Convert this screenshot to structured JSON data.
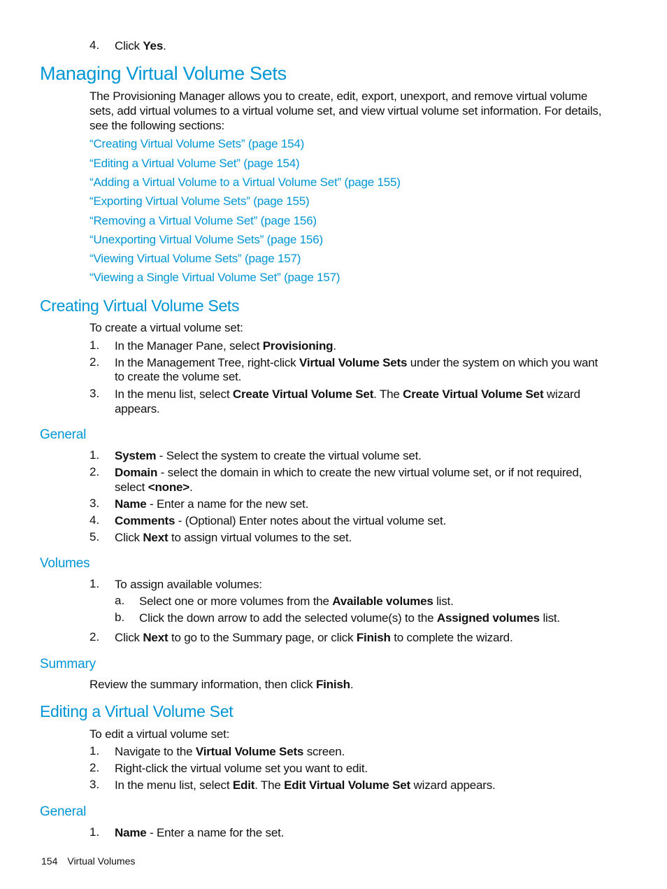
{
  "top_step": {
    "num": "4.",
    "pre": "Click ",
    "bold": "Yes",
    "post": "."
  },
  "managing": {
    "title": "Managing Virtual Volume Sets",
    "intro_lines": [
      "The Provisioning Manager allows you to create, edit, export, unexport, and remove virtual volume",
      "sets, add virtual volumes to a virtual volume set, and view virtual volume set information. For details,",
      "see the following sections:"
    ],
    "links": [
      "“Creating Virtual Volume Sets” (page 154)",
      "“Editing a Virtual Volume Set” (page 154)",
      "“Adding a Virtual Volume to a Virtual Volume Set” (page 155)",
      "“Exporting Virtual Volume Sets” (page 155)",
      "“Removing a Virtual Volume Set” (page 156)",
      "“Unexporting Virtual Volume Sets” (page 156)",
      "“Viewing Virtual Volume Sets” (page 157)",
      "“Viewing a Single Virtual Volume Set” (page 157)"
    ]
  },
  "creating": {
    "title": "Creating Virtual Volume Sets",
    "intro": "To create a virtual volume set:",
    "steps": [
      {
        "num": "1.",
        "t1": "In the Manager Pane, select ",
        "b1": "Provisioning",
        "t2": "."
      },
      {
        "num": "2.",
        "t1": "In the Management Tree, right-click ",
        "b1": "Virtual Volume Sets",
        "t2": " under the system on which you want",
        "line2": "to create the volume set."
      },
      {
        "num": "3.",
        "t1": "In the menu list, select ",
        "b1": "Create Virtual Volume Set",
        "t2": ". The ",
        "b2": "Create Virtual Volume Set",
        "t3": " wizard",
        "line2": "appears."
      }
    ],
    "general": {
      "title": "General",
      "steps": [
        {
          "num": "1.",
          "b1": "System",
          "t1": " - Select the system to create the virtual volume set."
        },
        {
          "num": "2.",
          "b1": "Domain",
          "t1": " - select the domain in which to create the new virtual volume set, or if not required,",
          "line2_pre": "select ",
          "line2_bold": "<none>",
          "line2_post": "."
        },
        {
          "num": "3.",
          "b1": "Name",
          "t1": " - Enter a name for the new set."
        },
        {
          "num": "4.",
          "b1": "Comments",
          "t1": " - (Optional) Enter notes about the virtual volume set."
        },
        {
          "num": "5.",
          "t0": "Click ",
          "b1": "Next",
          "t1": " to assign virtual volumes to the set."
        }
      ]
    },
    "volumes": {
      "title": "Volumes",
      "step1": {
        "num": "1.",
        "text": "To assign available volumes:"
      },
      "substeps": [
        {
          "num": "a.",
          "t1": "Select one or more volumes from the ",
          "b1": "Available volumes",
          "t2": " list."
        },
        {
          "num": "b.",
          "t1": "Click the down arrow to add the selected volume(s) to the ",
          "b1": "Assigned volumes",
          "t2": " list."
        }
      ],
      "step2": {
        "num": "2.",
        "t1": "Click ",
        "b1": "Next",
        "t2": " to go to the Summary page, or click ",
        "b2": "Finish",
        "t3": " to complete the wizard."
      }
    },
    "summary": {
      "title": "Summary",
      "t1": "Review the summary information, then click ",
      "b1": "Finish",
      "t2": "."
    }
  },
  "editing": {
    "title": "Editing a Virtual Volume Set",
    "intro": "To edit a virtual volume set:",
    "steps": [
      {
        "num": "1.",
        "t1": "Navigate to the ",
        "b1": "Virtual Volume Sets",
        "t2": " screen."
      },
      {
        "num": "2.",
        "t1": "Right-click the virtual volume set you want to edit."
      },
      {
        "num": "3.",
        "t1": "In the menu list, select ",
        "b1": "Edit",
        "t2": ". The ",
        "b2": "Edit Virtual Volume Set",
        "t3": " wizard appears."
      }
    ],
    "general": {
      "title": "General",
      "steps": [
        {
          "num": "1.",
          "b1": "Name",
          "t1": " - Enter a name for the set."
        }
      ]
    }
  },
  "footer": {
    "page_number": "154",
    "section": "Virtual Volumes"
  }
}
